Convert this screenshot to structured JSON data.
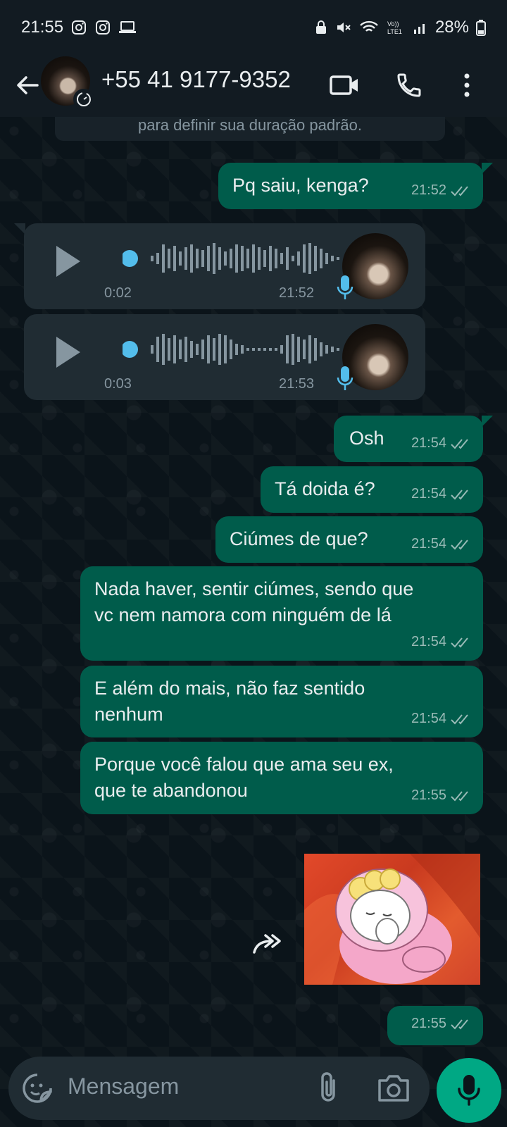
{
  "status_bar": {
    "time": "21:55",
    "battery": "28%"
  },
  "header": {
    "contact": "+55 41 9177-9352"
  },
  "banner": {
    "text": "para definir sua duração padrão."
  },
  "messages": [
    {
      "text": "Pq saiu, kenga?",
      "time": "21:52"
    },
    {
      "text": "Osh",
      "time": "21:54"
    },
    {
      "text": "Tá doida é?",
      "time": "21:54"
    },
    {
      "text": "Ciúmes de que?",
      "time": "21:54"
    },
    {
      "text": "Nada haver, sentir ciúmes, sendo que\nvc nem namora com ninguém de lá",
      "time": "21:54"
    },
    {
      "text": "E além do mais, não faz sentido\nnenhum",
      "time": "21:54"
    },
    {
      "text": "Porque você falou que ama seu ex,\nque te abandonou",
      "time": "21:55"
    }
  ],
  "voice_notes": [
    {
      "duration": "0:02",
      "time": "21:52"
    },
    {
      "duration": "0:03",
      "time": "21:53"
    }
  ],
  "sticker": {
    "time": "21:55"
  },
  "composer": {
    "placeholder": "Mensagem"
  },
  "colors": {
    "bubble_out": "#005c4b",
    "bubble_in": "#202c33",
    "accent": "#00a884",
    "play_dot": "#53bdeb"
  }
}
